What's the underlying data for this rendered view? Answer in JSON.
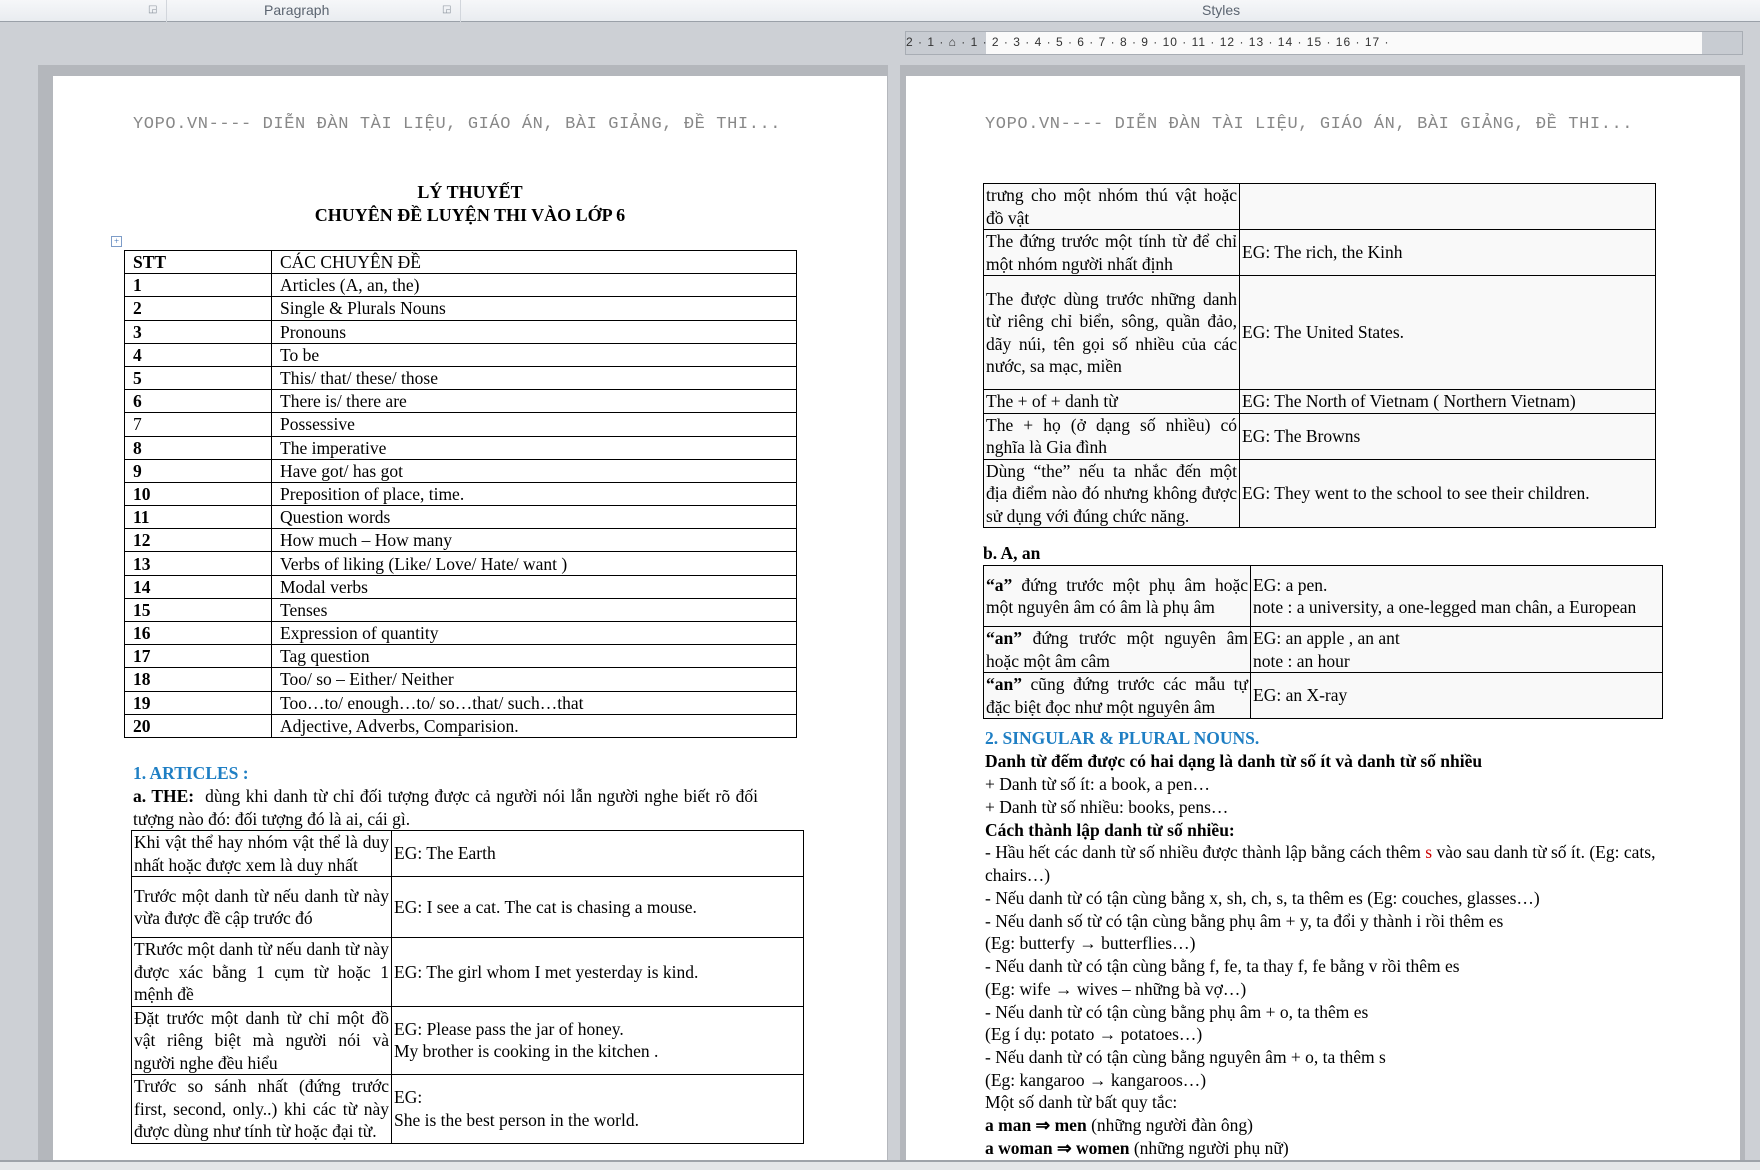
{
  "ribbon": {
    "groups": [
      "Paragraph",
      "Styles"
    ]
  },
  "ruler": {
    "labels": "2 · 1 · ⌂ · 1 · 2 · 3 · 4 · 5 · 6 · 7 · 8 · 9 · 10 · 11 · 12 · 13 · 14 · 15 · 16 · 17 ·"
  },
  "page_header": "YOPO.VN---- DIỄN ĐÀN TÀI LIỆU, GIÁO ÁN, BÀI GIẢNG, ĐỀ THI...",
  "left": {
    "title1": "LÝ THUYẾT",
    "title2": "CHUYÊN ĐỀ LUYỆN THI VÀO LỚP 6",
    "toc_header": [
      "STT",
      "CÁC CHUYÊN ĐỀ"
    ],
    "toc": [
      [
        "1",
        "Articles (A, an, the)"
      ],
      [
        "2",
        "Single & Plurals Nouns"
      ],
      [
        "3",
        "Pronouns"
      ],
      [
        "4",
        "To be"
      ],
      [
        "5",
        "This/ that/ these/ those"
      ],
      [
        "6",
        "There is/ there are"
      ],
      [
        "7",
        "Possessive"
      ],
      [
        "8",
        "The imperative"
      ],
      [
        "9",
        "Have got/ has got"
      ],
      [
        "10",
        "Preposition of place, time."
      ],
      [
        "11",
        "Question words"
      ],
      [
        "12",
        "How much – How many"
      ],
      [
        "13",
        "Verbs of liking (Like/ Love/ Hate/ want )"
      ],
      [
        "14",
        "Modal verbs"
      ],
      [
        "15",
        "Tenses"
      ],
      [
        "16",
        "Expression of quantity"
      ],
      [
        "17",
        "Tag question"
      ],
      [
        "18",
        "Too/ so – Either/ Neither"
      ],
      [
        "19",
        "Too…to/ enough…to/ so…that/ such…that"
      ],
      [
        "20",
        "Adjective, Adverbs, Comparision."
      ]
    ],
    "section1": "1. ARTICLES :",
    "the_label": "a. THE:",
    "the_text": "dùng khi danh từ chỉ đối tượng được cả người nói lẫn người nghe biết rõ đối tượng nào đó: đối tượng đó là ai, cái gì.",
    "the_rows": [
      [
        "Khi vật thể hay nhóm vật thể là duy nhất hoặc được xem là duy nhất",
        "EG: The Earth"
      ],
      [
        "Trước một danh từ nếu danh từ này vừa được đề cập trước đó",
        "EG: I see a cat. The cat is chasing a mouse."
      ],
      [
        "TRước một danh từ nếu danh từ này được xác bằng 1 cụm từ hoặc 1 mệnh đề",
        "EG: The girl whom I met yesterday is kind."
      ],
      [
        "Đặt trước một danh từ chỉ một đồ vật riêng biệt mà người nói và người nghe đều hiểu",
        "EG: Please pass the jar of honey.\nMy brother is cooking in the kitchen ."
      ],
      [
        "Trước so sánh nhất (đứng trước first, second, only..) khi các từ này được dùng như tính từ hoặc đại từ.",
        "EG:\nShe is the best person in the world."
      ]
    ]
  },
  "right": {
    "the_rows": [
      [
        "trưng cho một nhóm thú vật hoặc đồ vật",
        ""
      ],
      [
        "The đứng trước một tính từ để chỉ một nhóm người nhất định",
        "EG: The rich, the Kinh"
      ],
      [
        "The được dùng trước những danh từ riêng chỉ biển, sông, quần đảo, dãy núi, tên gọi số nhiều của các nước, sa mạc, miền",
        "EG: The United States."
      ],
      [
        "The + of + danh từ",
        "EG: The North of Vietnam ( Northern Vietnam)"
      ],
      [
        "The + họ (ở dạng số nhiều) có nghĩa là Gia đình",
        "EG: The Browns"
      ],
      [
        "Dùng “the” nếu ta nhắc đến một địa điểm nào đó nhưng không được sử dụng với đúng chức năng.",
        "EG: They went to the school to see their children."
      ]
    ],
    "a_an_label": "b. A, an",
    "a_an_rows": [
      {
        "bold": "“a”",
        "text": " đứng trước một phụ âm hoặc một nguyên âm có âm là phụ âm",
        "eg": "EG: a pen.\nnote : a university, a one-legged man chân, a European"
      },
      {
        "bold": "“an”",
        "text": " đứng trước một nguyên âm hoặc một âm câm",
        "eg": "EG: an apple , an ant\nnote : an hour"
      },
      {
        "bold": "“an”",
        "text": " cũng đứng trước các mẫu tự đặc biệt đọc như một nguyên âm",
        "eg": "EG:  an X-ray"
      }
    ],
    "section2": "2. SINGULAR & PLURAL NOUNS.",
    "intro": "Danh từ đếm được có hai dạng là danh từ số ít và danh từ số nhiều",
    "singular": "+ Danh từ số ít: a book, a pen…",
    "plural": "+ Danh từ số nhiều: books, pens…",
    "formation_title": "Cách thành lập danh từ số nhiều:",
    "rule1a": "- Hầu hết các danh từ số nhiều được thành lập bằng cách thêm ",
    "rule1s": "s",
    "rule1b": " vào sau danh từ số ít. (Eg: cats, chairs…)",
    "lines": [
      "- Nếu danh từ có tận cùng bằng x, sh, ch, s, ta thêm es (Eg: couches, glasses…)",
      "- Nếu danh số từ có tận cùng bằng phụ âm + y, ta đổi y thành i rồi thêm es",
      "(Eg: butterfy → butterflies…)",
      "- Nếu danh từ có tận cùng bằng f, fe, ta thay f, fe bằng v rồi thêm es",
      "(Eg: wife → wives – những bà vợ…)",
      "- Nếu danh từ có tận cùng bằng phụ âm + o, ta thêm es",
      "(Eg í dụ: potato → potatoes…)",
      "- Nếu danh từ có tận cùng bằng nguyên âm + o, ta thêm s",
      "(Eg: kangaroo → kangaroos…)",
      "Một số danh từ bất quy tắc:"
    ],
    "irregular": [
      {
        "bold": "a man ⇒ men",
        "text": " (những người đàn ông)"
      },
      {
        "bold": "a woman ⇒ women",
        "text": " (những người phụ nữ)"
      }
    ]
  }
}
